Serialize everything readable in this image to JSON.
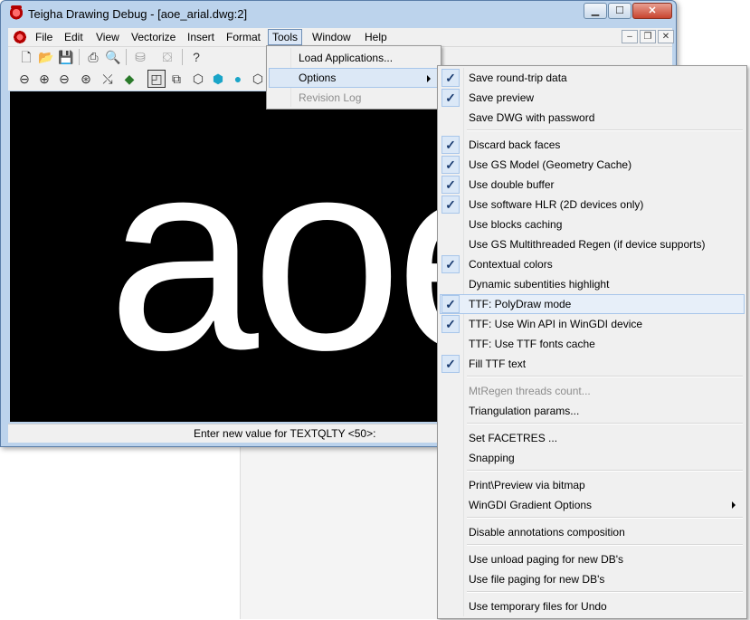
{
  "window": {
    "title": "Teigha Drawing Debug - [aoe_arial.dwg:2]"
  },
  "menubar": [
    "File",
    "Edit",
    "View",
    "Vectorize",
    "Insert",
    "Format",
    "Tools",
    "Window",
    "Help"
  ],
  "canvas": {
    "text": "aoe"
  },
  "status": {
    "text": "Enter new value for TEXTQLTY <50>:"
  },
  "tools_menu": {
    "load_applications": "Load Applications...",
    "options": "Options",
    "revision_log": "Revision Log"
  },
  "options_menu": {
    "items": [
      "Save round-trip data",
      "Save preview",
      "Save DWG with password",
      "Discard back faces",
      "Use GS Model (Geometry Cache)",
      "Use double buffer",
      "Use software HLR (2D devices only)",
      "Use blocks caching",
      "Use GS Multithreaded Regen (if device supports)",
      "Contextual colors",
      "Dynamic subentities highlight",
      "TTF: PolyDraw mode",
      "TTF: Use Win API in WinGDI device",
      "TTF: Use TTF fonts cache",
      "Fill TTF text",
      "MtRegen threads count...",
      "Triangulation params...",
      "Set FACETRES ...",
      "Snapping",
      "Print\\Preview via bitmap",
      "WinGDI Gradient Options",
      "Disable annotations composition",
      "Use unload paging for new DB's",
      "Use file paging for new DB's",
      "Use temporary files for Undo"
    ],
    "checked": [
      true,
      true,
      false,
      true,
      true,
      true,
      true,
      false,
      false,
      true,
      false,
      true,
      true,
      false,
      true,
      false,
      false,
      false,
      false,
      false,
      false,
      false,
      false,
      false,
      false
    ]
  }
}
